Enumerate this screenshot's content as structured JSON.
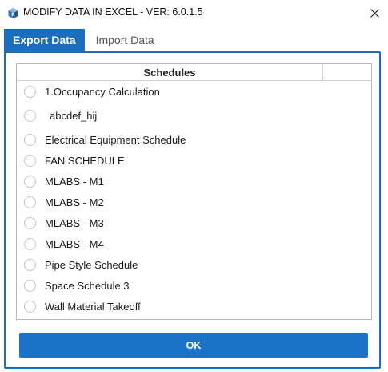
{
  "window": {
    "title": "MODIFY DATA IN EXCEL - VER: 6.0.1.5",
    "icon": "revit-cube-icon",
    "close_icon": "close-icon"
  },
  "tabs": [
    {
      "label": "Export Data",
      "active": true
    },
    {
      "label": "Import Data",
      "active": false
    }
  ],
  "grid": {
    "header": "Schedules",
    "rows": [
      {
        "label": "1.Occupancy Calculation",
        "selected": false
      },
      {
        "label": "abcdef_hij",
        "selected": false
      },
      {
        "label": "Electrical Equipment Schedule",
        "selected": false
      },
      {
        "label": "FAN SCHEDULE",
        "selected": false
      },
      {
        "label": "MLABS - M1",
        "selected": false
      },
      {
        "label": "MLABS - M2",
        "selected": false
      },
      {
        "label": "MLABS - M3",
        "selected": false
      },
      {
        "label": "MLABS - M4",
        "selected": false
      },
      {
        "label": "Pipe Style Schedule",
        "selected": false
      },
      {
        "label": "Space Schedule 3",
        "selected": false
      },
      {
        "label": "Wall Material Takeoff",
        "selected": false
      }
    ]
  },
  "ok_button": {
    "label": "OK"
  },
  "colors": {
    "accent": "#1a6ec1",
    "button": "#1a73c8"
  }
}
